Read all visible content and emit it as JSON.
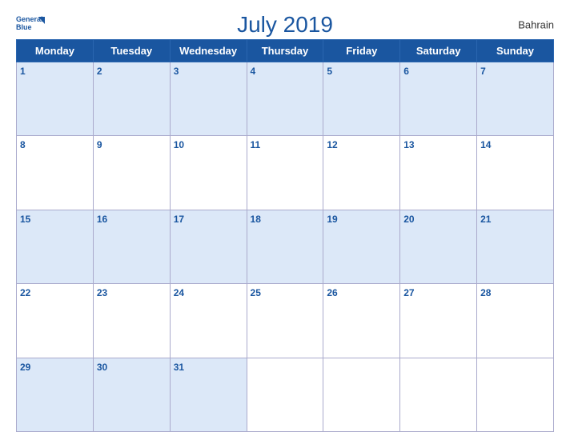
{
  "header": {
    "title": "July 2019",
    "country": "Bahrain",
    "logo_line1": "General",
    "logo_line2": "Blue"
  },
  "days_of_week": [
    "Monday",
    "Tuesday",
    "Wednesday",
    "Thursday",
    "Friday",
    "Saturday",
    "Sunday"
  ],
  "weeks": [
    [
      "1",
      "2",
      "3",
      "4",
      "5",
      "6",
      "7"
    ],
    [
      "8",
      "9",
      "10",
      "11",
      "12",
      "13",
      "14"
    ],
    [
      "15",
      "16",
      "17",
      "18",
      "19",
      "20",
      "21"
    ],
    [
      "22",
      "23",
      "24",
      "25",
      "26",
      "27",
      "28"
    ],
    [
      "29",
      "30",
      "31",
      "",
      "",
      "",
      ""
    ]
  ]
}
